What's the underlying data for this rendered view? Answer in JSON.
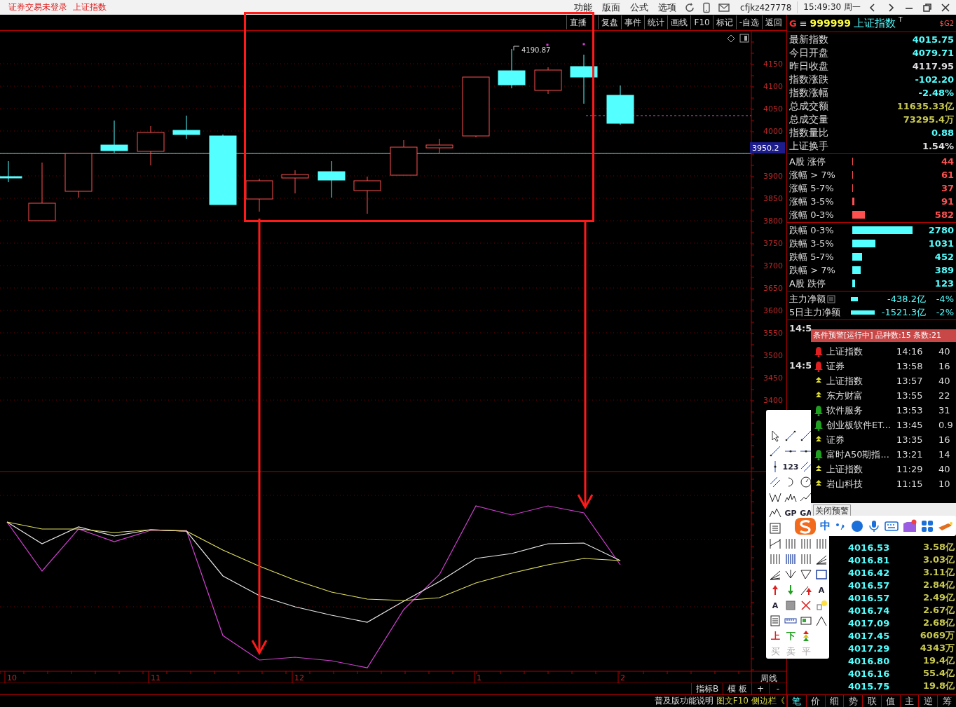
{
  "title_bar": {
    "status": "证券交易未登录",
    "security": "上证指数",
    "menu": [
      "功能",
      "版面",
      "公式",
      "选项"
    ],
    "user": "cfjkz427778",
    "clock": "15:49:30 周一"
  },
  "toolbar": {
    "buttons": [
      "直播",
      "复盘",
      "事件",
      "统计",
      "画线",
      "F10",
      "标记",
      "-自选",
      "返回"
    ]
  },
  "chart": {
    "y_labels": [
      "4150",
      "4100",
      "4050",
      "4000",
      "3900",
      "3850",
      "3800",
      "3750",
      "3700",
      "3650",
      "3600",
      "3550",
      "3500",
      "3450",
      "3400"
    ],
    "price_badge": "3950.2",
    "high_label": "4190.87",
    "x_labels": [
      "10",
      "11",
      "12",
      "1",
      "2"
    ],
    "period": "周线"
  },
  "indicator_bar": {
    "buttons": [
      "指标B",
      "模 板",
      "+",
      "-"
    ]
  },
  "footer": {
    "links": [
      "普及版功能说明",
      "图文F10",
      "侧边栏《"
    ]
  },
  "quote": {
    "flag": "G",
    "menu_glyph": "≡",
    "code": "999999",
    "name": "上证指数",
    "mark": "T",
    "tag": "$G2",
    "stats": [
      {
        "label": "最新指数",
        "value": "4015.75",
        "color": "#54ffff"
      },
      {
        "label": "今日开盘",
        "value": "4079.71",
        "color": "#54ffff"
      },
      {
        "label": "昨日收盘",
        "value": "4117.95",
        "color": "#dddddd"
      },
      {
        "label": "指数涨跌",
        "value": "-102.20",
        "color": "#54ffff"
      },
      {
        "label": "指数涨幅",
        "value": "-2.48%",
        "color": "#54ffff"
      },
      {
        "label": "总成交额",
        "value": "11635.33亿",
        "color": "#c8c850"
      },
      {
        "label": "总成交量",
        "value": "73295.4万",
        "color": "#c8c850"
      },
      {
        "label": "指数量比",
        "value": "0.88",
        "color": "#54ffff"
      },
      {
        "label": "上证换手",
        "value": "1.54%",
        "color": "#dddddd"
      }
    ],
    "rises": [
      {
        "label": "A股 涨停",
        "value": "44"
      },
      {
        "label": "涨幅 > 7%",
        "value": "61"
      },
      {
        "label": "涨幅 5-7%",
        "value": "37"
      },
      {
        "label": "涨幅 3-5%",
        "value": "91"
      },
      {
        "label": "涨幅 0-3%",
        "value": "582"
      }
    ],
    "falls": [
      {
        "label": "跌幅 0-3%",
        "value": "2780"
      },
      {
        "label": "跌幅 3-5%",
        "value": "1031"
      },
      {
        "label": "跌幅 5-7%",
        "value": "452"
      },
      {
        "label": "跌幅 > 7%",
        "value": "389"
      },
      {
        "label": "A股 跌停",
        "value": "123"
      }
    ],
    "money": [
      {
        "label": "主力净额",
        "value": "-438.2亿",
        "pct": "-4%"
      },
      {
        "label": "5日主力净额",
        "value": "-1521.3亿",
        "pct": "-2%"
      }
    ]
  },
  "ticks": {
    "times": [
      "14:5",
      "14:5"
    ],
    "rows": [
      {
        "price": "4016.53",
        "amount": "3.58亿"
      },
      {
        "price": "4016.81",
        "amount": "3.03亿"
      },
      {
        "price": "4016.42",
        "amount": "3.11亿"
      },
      {
        "price": "4016.57",
        "amount": "2.84亿"
      },
      {
        "price": "4016.57",
        "amount": "2.49亿"
      },
      {
        "price": "4016.74",
        "amount": "2.67亿"
      },
      {
        "price": "4017.09",
        "amount": "2.68亿"
      },
      {
        "price": "4017.45",
        "amount": "6069万"
      },
      {
        "price": "4017.29",
        "amount": "4343万"
      },
      {
        "price": "4016.80",
        "amount": "19.4亿"
      },
      {
        "price": "4016.16",
        "amount": "55.4亿"
      },
      {
        "price": "4015.75",
        "amount": "19.8亿"
      }
    ]
  },
  "alerts": {
    "title": "条件预警[运行中] 品种数:15 条数:21",
    "close_button": "关闭预警",
    "rows": [
      {
        "kind": "bell",
        "color": "#e02020",
        "name": "上证指数",
        "time": "14:16",
        "value": "40"
      },
      {
        "kind": "bell",
        "color": "#e02020",
        "name": "证券",
        "time": "13:58",
        "value": "16"
      },
      {
        "kind": "rise",
        "color": "#e0e030",
        "name": "上证指数",
        "time": "13:57",
        "value": "40"
      },
      {
        "kind": "rise",
        "color": "#e0e030",
        "name": "东方财富",
        "time": "13:55",
        "value": "22"
      },
      {
        "kind": "bell",
        "color": "#20a020",
        "name": "软件服务",
        "time": "13:53",
        "value": "31"
      },
      {
        "kind": "bell",
        "color": "#20a020",
        "name": "创业板软件ET...",
        "time": "13:45",
        "value": "0.9"
      },
      {
        "kind": "rise",
        "color": "#e0e030",
        "name": "证券",
        "time": "13:35",
        "value": "16"
      },
      {
        "kind": "bell",
        "color": "#20a020",
        "name": "富时A50期指...",
        "time": "13:21",
        "value": "14"
      },
      {
        "kind": "rise",
        "color": "#e0e030",
        "name": "上证指数",
        "time": "11:29",
        "value": "40"
      },
      {
        "kind": "rise",
        "color": "#e0e030",
        "name": "岩山科技",
        "time": "11:15",
        "value": "10"
      }
    ]
  },
  "drawing_tools": {
    "labels": [
      "123",
      "GP",
      "GA",
      "A",
      "A",
      "上",
      "下",
      "买",
      "卖",
      "平"
    ]
  },
  "ime": {
    "mode": "中"
  },
  "side_tabs": [
    {
      "label": "笔",
      "selected": true
    },
    {
      "label": "价",
      "selected": false
    },
    {
      "label": "细",
      "selected": false
    },
    {
      "label": "势",
      "selected": false
    },
    {
      "label": "联",
      "selected": false
    },
    {
      "label": "值",
      "selected": false
    },
    {
      "label": "主",
      "selected": false
    },
    {
      "label": "逆",
      "selected": false
    },
    {
      "label": "筹",
      "selected": false
    }
  ]
}
